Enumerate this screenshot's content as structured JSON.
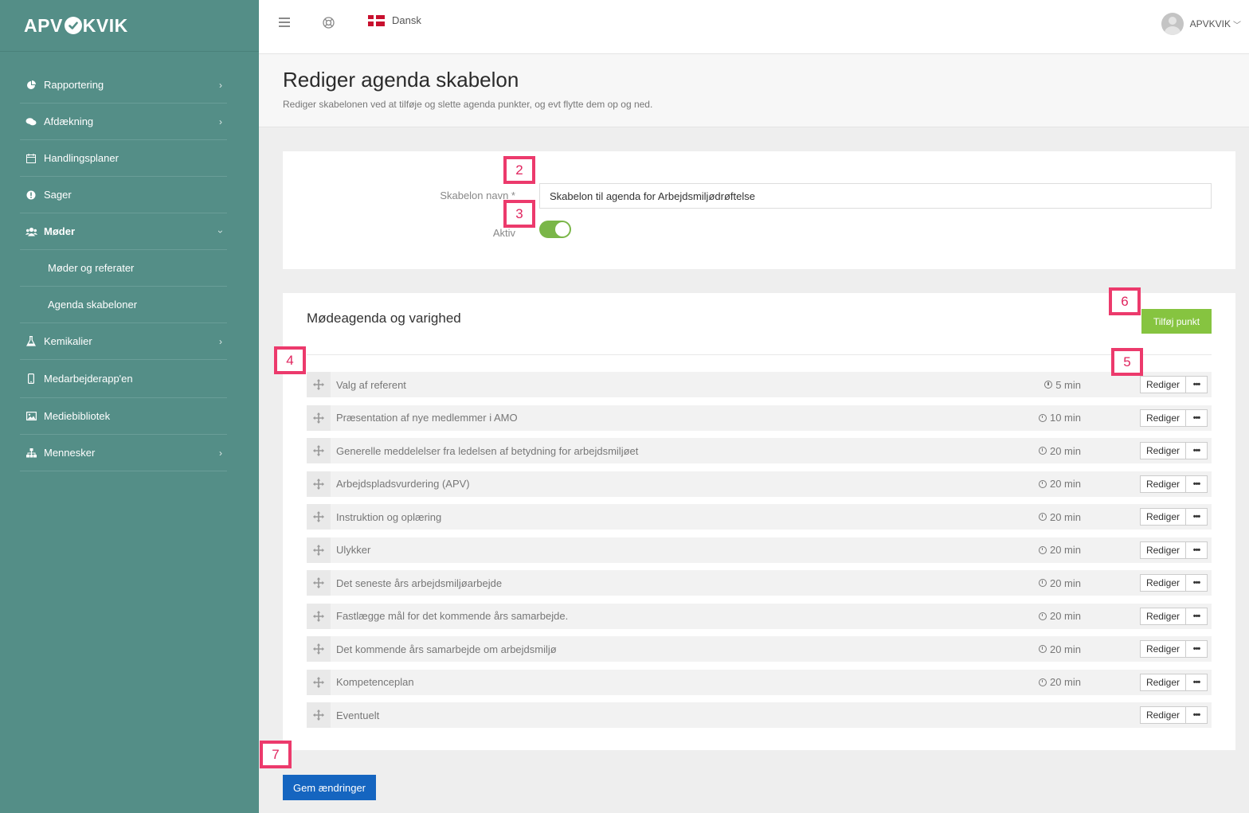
{
  "brand": {
    "left": "APV",
    "right": "KVIK"
  },
  "sidebar": {
    "items": [
      {
        "label": "Rapportering",
        "icon": "pie-chart-icon"
      },
      {
        "label": "Afdækning",
        "icon": "comments-icon"
      },
      {
        "label": "Handlingsplaner",
        "icon": "calendar-icon"
      },
      {
        "label": "Sager",
        "icon": "alert-circle-icon"
      },
      {
        "label": "Møder",
        "icon": "users-icon"
      },
      {
        "label": "Møder og referater"
      },
      {
        "label": "Agenda skabeloner"
      },
      {
        "label": "Kemikalier",
        "icon": "flask-icon"
      },
      {
        "label": "Medarbejderapp'en",
        "icon": "mobile-icon"
      },
      {
        "label": "Mediebibliotek",
        "icon": "image-icon"
      },
      {
        "label": "Mennesker",
        "icon": "org-chart-icon"
      }
    ]
  },
  "topbar": {
    "language": "Dansk",
    "user": "APVKVIK"
  },
  "page": {
    "title": "Rediger agenda skabelon",
    "subtitle": "Rediger skabelonen ved at tilføje og slette agenda punkter, og evt flytte dem op og ned."
  },
  "form": {
    "name_label": "Skabelon navn *",
    "name_value": "Skabelon til agenda for Arbejdsmiljødrøftelse",
    "active_label": "Aktiv",
    "active": true
  },
  "agenda": {
    "title": "Mødeagenda og varighed",
    "add_label": "Tilføj punkt",
    "edit_label": "Rediger",
    "more_label": "•••",
    "items": [
      {
        "label": "Valg af referent",
        "duration": "5 min"
      },
      {
        "label": "Præsentation af nye medlemmer i AMO",
        "duration": "10 min"
      },
      {
        "label": "Generelle meddelelser fra ledelsen af betydning for arbejdsmiljøet",
        "duration": "20 min"
      },
      {
        "label": "Arbejdspladsvurdering (APV)",
        "duration": "20 min"
      },
      {
        "label": "Instruktion og oplæring",
        "duration": "20 min"
      },
      {
        "label": "Ulykker",
        "duration": "20 min"
      },
      {
        "label": "Det seneste års arbejdsmiljøarbejde",
        "duration": "20 min"
      },
      {
        "label": "Fastlægge mål for det kommende års samarbejde.",
        "duration": "20 min"
      },
      {
        "label": "Det kommende års samarbejde om arbejdsmiljø",
        "duration": "20 min"
      },
      {
        "label": "Kompetenceplan",
        "duration": "20 min"
      },
      {
        "label": "Eventuelt",
        "duration": ""
      }
    ]
  },
  "save_label": "Gem ændringer",
  "annotations": {
    "a2": "2",
    "a3": "3",
    "a4": "4",
    "a5": "5",
    "a6": "6",
    "a7": "7"
  },
  "colors": {
    "sidebar": "#548e87",
    "add_button": "#86c440",
    "save_button": "#1565c0",
    "badge": "#ec3a6c",
    "toggle_on": "#7ab648"
  }
}
